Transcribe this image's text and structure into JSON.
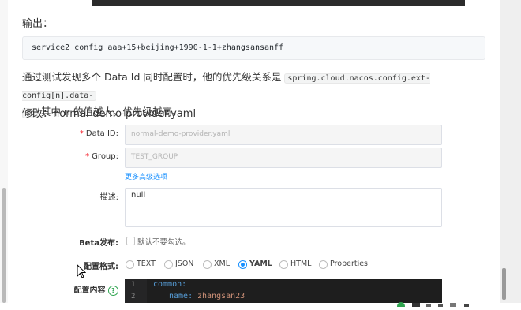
{
  "doc": {
    "output_heading": "输出：",
    "code_line": "service2 config aaa+15+beijing+1990-1-1+zhangsansanff",
    "para_text1": "通过测试发现多个 Data Id 同时配置时，他的优先级关系是",
    "para_code1": "spring.cloud.nacos.config.ext-config[n].data-",
    "para_code2": "id",
    "para_text2": "其中 n 的值越大，优先级越高。",
    "modify_heading": "修改：normal-demo-provider.yaml"
  },
  "form": {
    "dataid": {
      "required": "*",
      "label": "Data ID:",
      "value": "normal-demo-provider.yaml"
    },
    "group": {
      "required": "*",
      "label": "Group:",
      "value": "TEST_GROUP"
    },
    "advanced_link": "更多高级选项",
    "description": {
      "label": "描述:",
      "value": "null"
    },
    "beta": {
      "label": "Beta发布:",
      "checkbox_label": "默认不要勾选。"
    },
    "format": {
      "label": "配置格式:",
      "options": [
        "TEXT",
        "JSON",
        "XML",
        "YAML",
        "HTML",
        "Properties"
      ],
      "selected": "YAML"
    },
    "content": {
      "label": "配置内容",
      "help": "?"
    }
  },
  "editor": {
    "lines": [
      {
        "no": "1",
        "key": "common:"
      },
      {
        "no": "2",
        "key": "name:",
        "val": "zhangsan23"
      }
    ]
  },
  "colors": {
    "accent": "#1890ff",
    "required": "#f5222d",
    "editor_bg": "#1e1e1e"
  }
}
